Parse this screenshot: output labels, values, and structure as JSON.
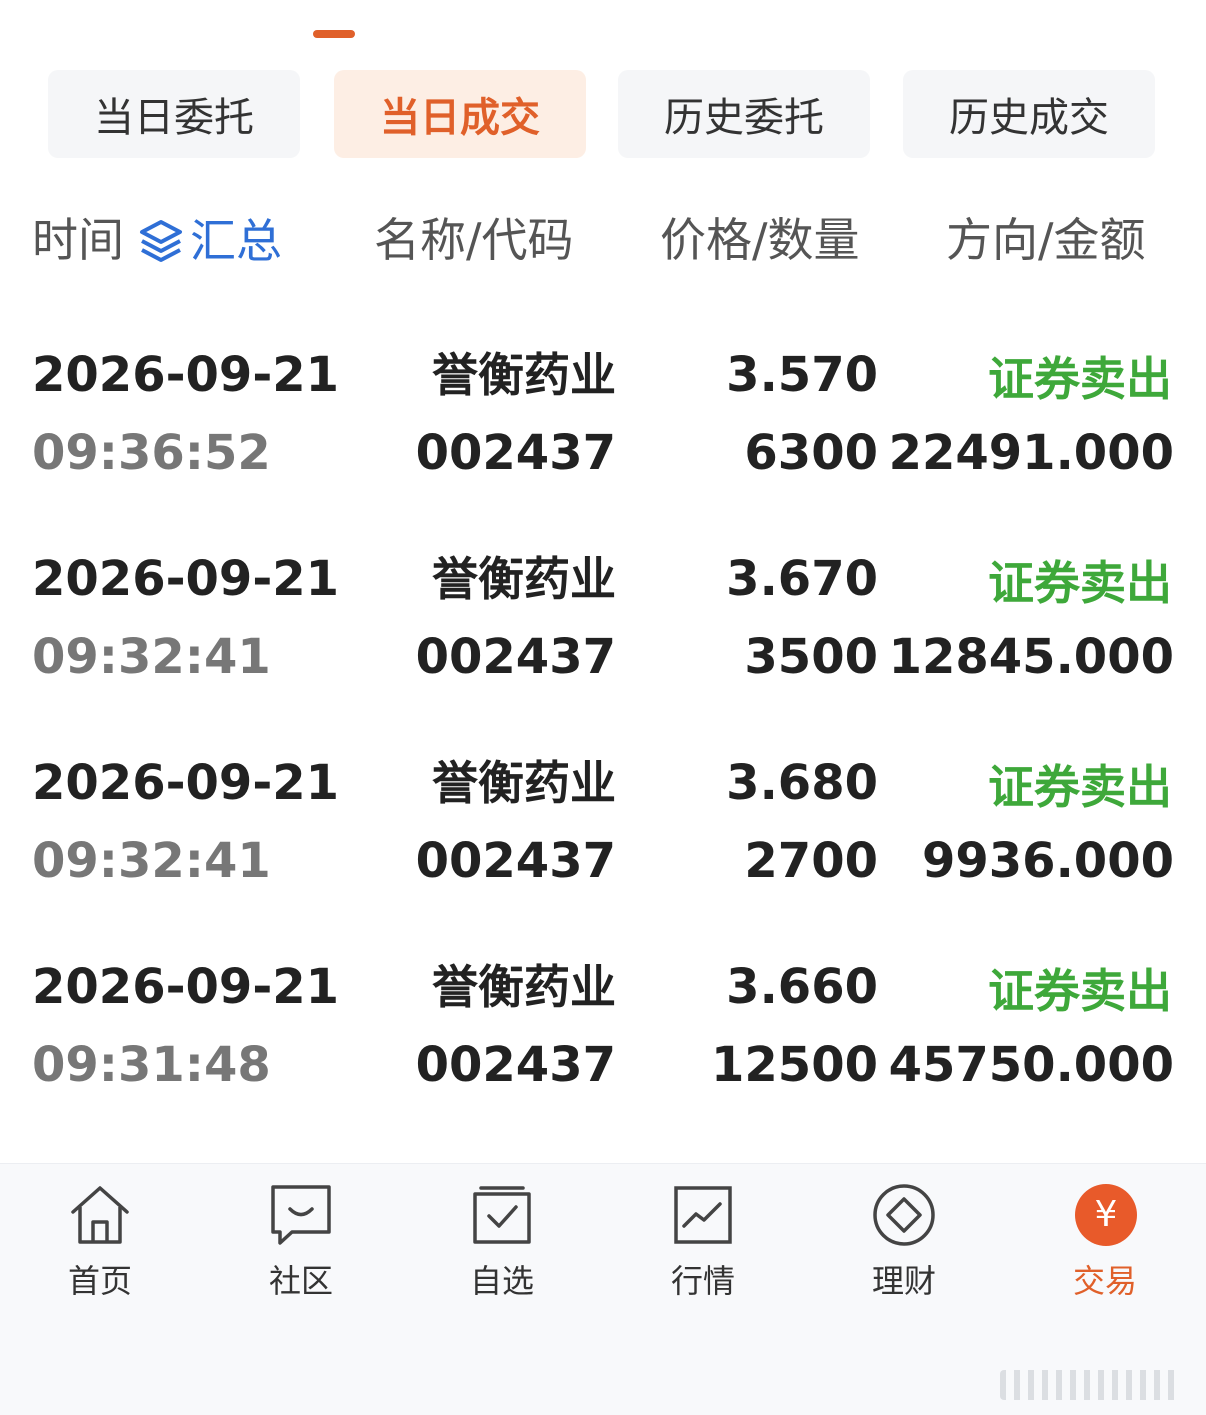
{
  "tabs": [
    {
      "label": "当日委托"
    },
    {
      "label": "当日成交"
    },
    {
      "label": "历史委托"
    },
    {
      "label": "历史成交"
    }
  ],
  "active_tab": "当日成交",
  "header": {
    "time": "时间",
    "summary": "汇总",
    "name_code": "名称/代码",
    "price_qty": "价格/数量",
    "dir_amount": "方向/金额"
  },
  "trades": [
    {
      "date": "2026-09-21",
      "time": "09:36:52",
      "name": "誉衡药业",
      "code": "002437",
      "price": "3.570",
      "qty": "6300",
      "direction": "证券卖出",
      "amount": "22491.000"
    },
    {
      "date": "2026-09-21",
      "time": "09:32:41",
      "name": "誉衡药业",
      "code": "002437",
      "price": "3.670",
      "qty": "3500",
      "direction": "证券卖出",
      "amount": "12845.000"
    },
    {
      "date": "2026-09-21",
      "time": "09:32:41",
      "name": "誉衡药业",
      "code": "002437",
      "price": "3.680",
      "qty": "2700",
      "direction": "证券卖出",
      "amount": "9936.000"
    },
    {
      "date": "2026-09-21",
      "time": "09:31:48",
      "name": "誉衡药业",
      "code": "002437",
      "price": "3.660",
      "qty": "12500",
      "direction": "证券卖出",
      "amount": "45750.000"
    }
  ],
  "nav": [
    {
      "label": "首页",
      "icon": "home-icon"
    },
    {
      "label": "社区",
      "icon": "chat-icon"
    },
    {
      "label": "自选",
      "icon": "watchlist-icon"
    },
    {
      "label": "行情",
      "icon": "market-chart-icon"
    },
    {
      "label": "理财",
      "icon": "diamond-icon"
    },
    {
      "label": "交易",
      "icon": "yen-icon",
      "symbol": "¥"
    }
  ],
  "colors": {
    "accent": "#e0602a",
    "sell_green": "#3ea83a",
    "summary_blue": "#2f6fd6"
  }
}
